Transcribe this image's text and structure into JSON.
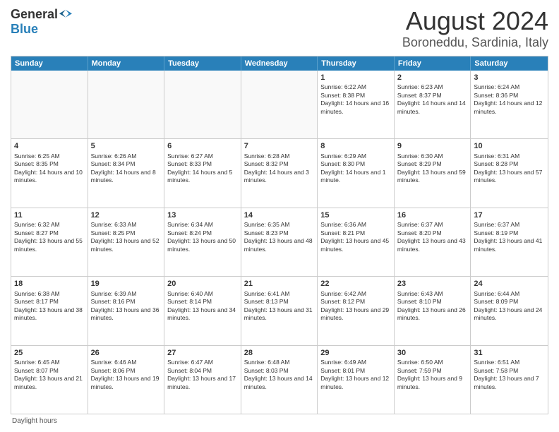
{
  "logo": {
    "general": "General",
    "blue": "Blue"
  },
  "title": "August 2024",
  "subtitle": "Boroneddu, Sardinia, Italy",
  "weekdays": [
    "Sunday",
    "Monday",
    "Tuesday",
    "Wednesday",
    "Thursday",
    "Friday",
    "Saturday"
  ],
  "footer": "Daylight hours",
  "weeks": [
    [
      {
        "day": "",
        "info": ""
      },
      {
        "day": "",
        "info": ""
      },
      {
        "day": "",
        "info": ""
      },
      {
        "day": "",
        "info": ""
      },
      {
        "day": "1",
        "info": "Sunrise: 6:22 AM\nSunset: 8:38 PM\nDaylight: 14 hours and 16 minutes."
      },
      {
        "day": "2",
        "info": "Sunrise: 6:23 AM\nSunset: 8:37 PM\nDaylight: 14 hours and 14 minutes."
      },
      {
        "day": "3",
        "info": "Sunrise: 6:24 AM\nSunset: 8:36 PM\nDaylight: 14 hours and 12 minutes."
      }
    ],
    [
      {
        "day": "4",
        "info": "Sunrise: 6:25 AM\nSunset: 8:35 PM\nDaylight: 14 hours and 10 minutes."
      },
      {
        "day": "5",
        "info": "Sunrise: 6:26 AM\nSunset: 8:34 PM\nDaylight: 14 hours and 8 minutes."
      },
      {
        "day": "6",
        "info": "Sunrise: 6:27 AM\nSunset: 8:33 PM\nDaylight: 14 hours and 5 minutes."
      },
      {
        "day": "7",
        "info": "Sunrise: 6:28 AM\nSunset: 8:32 PM\nDaylight: 14 hours and 3 minutes."
      },
      {
        "day": "8",
        "info": "Sunrise: 6:29 AM\nSunset: 8:30 PM\nDaylight: 14 hours and 1 minute."
      },
      {
        "day": "9",
        "info": "Sunrise: 6:30 AM\nSunset: 8:29 PM\nDaylight: 13 hours and 59 minutes."
      },
      {
        "day": "10",
        "info": "Sunrise: 6:31 AM\nSunset: 8:28 PM\nDaylight: 13 hours and 57 minutes."
      }
    ],
    [
      {
        "day": "11",
        "info": "Sunrise: 6:32 AM\nSunset: 8:27 PM\nDaylight: 13 hours and 55 minutes."
      },
      {
        "day": "12",
        "info": "Sunrise: 6:33 AM\nSunset: 8:25 PM\nDaylight: 13 hours and 52 minutes."
      },
      {
        "day": "13",
        "info": "Sunrise: 6:34 AM\nSunset: 8:24 PM\nDaylight: 13 hours and 50 minutes."
      },
      {
        "day": "14",
        "info": "Sunrise: 6:35 AM\nSunset: 8:23 PM\nDaylight: 13 hours and 48 minutes."
      },
      {
        "day": "15",
        "info": "Sunrise: 6:36 AM\nSunset: 8:21 PM\nDaylight: 13 hours and 45 minutes."
      },
      {
        "day": "16",
        "info": "Sunrise: 6:37 AM\nSunset: 8:20 PM\nDaylight: 13 hours and 43 minutes."
      },
      {
        "day": "17",
        "info": "Sunrise: 6:37 AM\nSunset: 8:19 PM\nDaylight: 13 hours and 41 minutes."
      }
    ],
    [
      {
        "day": "18",
        "info": "Sunrise: 6:38 AM\nSunset: 8:17 PM\nDaylight: 13 hours and 38 minutes."
      },
      {
        "day": "19",
        "info": "Sunrise: 6:39 AM\nSunset: 8:16 PM\nDaylight: 13 hours and 36 minutes."
      },
      {
        "day": "20",
        "info": "Sunrise: 6:40 AM\nSunset: 8:14 PM\nDaylight: 13 hours and 34 minutes."
      },
      {
        "day": "21",
        "info": "Sunrise: 6:41 AM\nSunset: 8:13 PM\nDaylight: 13 hours and 31 minutes."
      },
      {
        "day": "22",
        "info": "Sunrise: 6:42 AM\nSunset: 8:12 PM\nDaylight: 13 hours and 29 minutes."
      },
      {
        "day": "23",
        "info": "Sunrise: 6:43 AM\nSunset: 8:10 PM\nDaylight: 13 hours and 26 minutes."
      },
      {
        "day": "24",
        "info": "Sunrise: 6:44 AM\nSunset: 8:09 PM\nDaylight: 13 hours and 24 minutes."
      }
    ],
    [
      {
        "day": "25",
        "info": "Sunrise: 6:45 AM\nSunset: 8:07 PM\nDaylight: 13 hours and 21 minutes."
      },
      {
        "day": "26",
        "info": "Sunrise: 6:46 AM\nSunset: 8:06 PM\nDaylight: 13 hours and 19 minutes."
      },
      {
        "day": "27",
        "info": "Sunrise: 6:47 AM\nSunset: 8:04 PM\nDaylight: 13 hours and 17 minutes."
      },
      {
        "day": "28",
        "info": "Sunrise: 6:48 AM\nSunset: 8:03 PM\nDaylight: 13 hours and 14 minutes."
      },
      {
        "day": "29",
        "info": "Sunrise: 6:49 AM\nSunset: 8:01 PM\nDaylight: 13 hours and 12 minutes."
      },
      {
        "day": "30",
        "info": "Sunrise: 6:50 AM\nSunset: 7:59 PM\nDaylight: 13 hours and 9 minutes."
      },
      {
        "day": "31",
        "info": "Sunrise: 6:51 AM\nSunset: 7:58 PM\nDaylight: 13 hours and 7 minutes."
      }
    ]
  ]
}
